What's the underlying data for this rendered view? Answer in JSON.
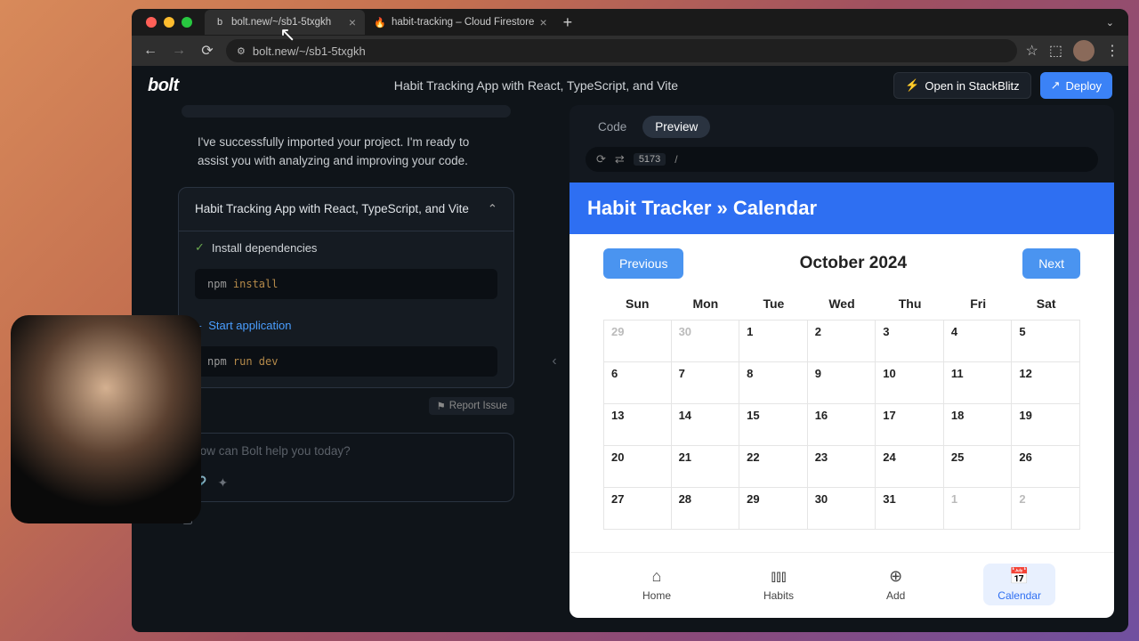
{
  "browser": {
    "tabs": [
      {
        "title": "bolt.new/~/sb1-5txgkh",
        "favicon": "b"
      },
      {
        "title": "habit-tracking – Cloud Firestore",
        "favicon": "🔥"
      }
    ],
    "address": "bolt.new/~/sb1-5txgkh"
  },
  "header": {
    "logo": "bolt",
    "title": "Habit Tracking App with React, TypeScript, and Vite",
    "open_btn": "Open in StackBlitz",
    "deploy_btn": "Deploy"
  },
  "chat": {
    "assistant": "I've successfully imported your project. I'm ready to assist you with analyzing and improving your code.",
    "task_title": "Habit Tracking App with React, TypeScript, and Vite",
    "steps": {
      "install_label": "Install dependencies",
      "install_cmd_pre": "npm ",
      "install_cmd_kw": "install",
      "start_label": "Start application",
      "start_cmd_pre": "npm ",
      "start_cmd_kw": "run dev"
    },
    "report": "Report Issue",
    "input_placeholder": "How can Bolt help you today?"
  },
  "preview": {
    "tabs": {
      "code": "Code",
      "preview": "Preview"
    },
    "port": "5173",
    "path": "/",
    "app_title": "Habit Tracker » Calendar",
    "calendar": {
      "prev": "Previous",
      "next": "Next",
      "month": "October 2024",
      "days": [
        "Sun",
        "Mon",
        "Tue",
        "Wed",
        "Thu",
        "Fri",
        "Sat"
      ],
      "rows": [
        [
          {
            "d": "29",
            "m": true
          },
          {
            "d": "30",
            "m": true
          },
          {
            "d": "1"
          },
          {
            "d": "2"
          },
          {
            "d": "3"
          },
          {
            "d": "4"
          },
          {
            "d": "5"
          }
        ],
        [
          {
            "d": "6"
          },
          {
            "d": "7"
          },
          {
            "d": "8"
          },
          {
            "d": "9"
          },
          {
            "d": "10"
          },
          {
            "d": "11"
          },
          {
            "d": "12"
          }
        ],
        [
          {
            "d": "13"
          },
          {
            "d": "14"
          },
          {
            "d": "15"
          },
          {
            "d": "16"
          },
          {
            "d": "17"
          },
          {
            "d": "18"
          },
          {
            "d": "19"
          }
        ],
        [
          {
            "d": "20"
          },
          {
            "d": "21"
          },
          {
            "d": "22"
          },
          {
            "d": "23"
          },
          {
            "d": "24"
          },
          {
            "d": "25"
          },
          {
            "d": "26"
          }
        ],
        [
          {
            "d": "27"
          },
          {
            "d": "28"
          },
          {
            "d": "29"
          },
          {
            "d": "30"
          },
          {
            "d": "31"
          },
          {
            "d": "1",
            "m": true
          },
          {
            "d": "2",
            "m": true
          }
        ]
      ]
    },
    "nav": {
      "home": "Home",
      "habits": "Habits",
      "add": "Add",
      "calendar": "Calendar"
    }
  }
}
